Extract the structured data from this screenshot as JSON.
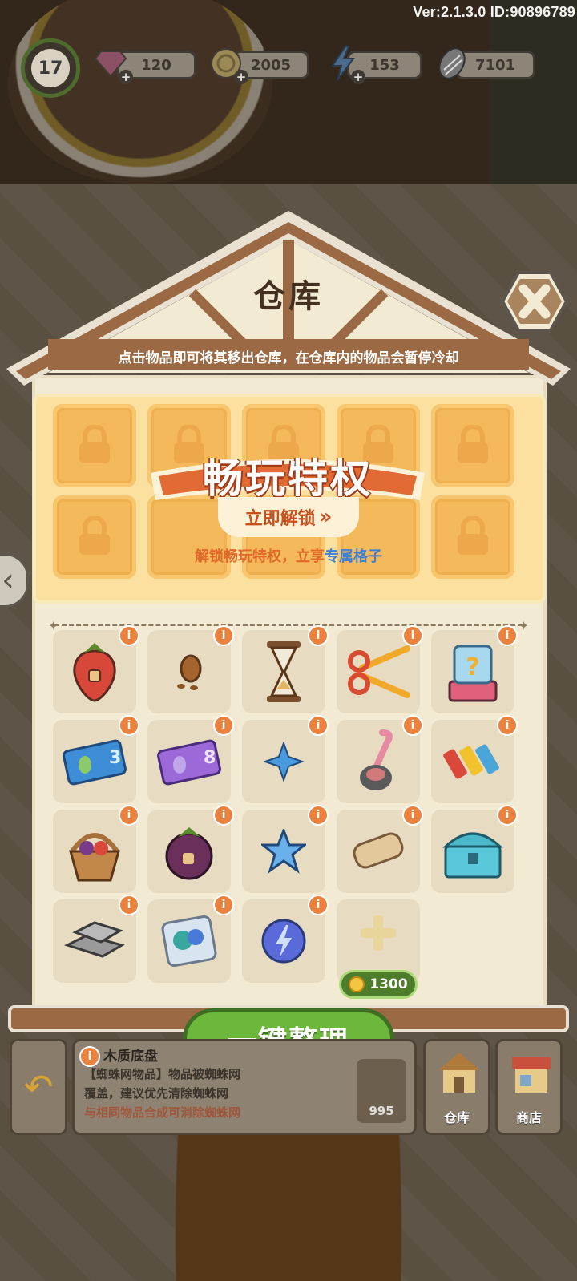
{
  "version_text": "Ver:2.1.3.0 ID:90896789",
  "top_bar": {
    "level": "17",
    "gems": "120",
    "coins": "2005",
    "energy": "153",
    "seeds": "7101"
  },
  "warehouse": {
    "title": "仓库",
    "subtitle": "点击物品即可将其移出仓库，在仓库内的物品会暂停冷却",
    "promo_title": "畅玩特权",
    "promo_button": "立即解锁",
    "promo_button_arrows": "»",
    "promo_desc_prefix": "解锁畅玩特权，立享",
    "promo_desc_highlight": "专属格子",
    "expand_price": "1300",
    "sort_button": "一键整理",
    "info_glyph": "i",
    "items": [
      {
        "icon": "strawberry-icon"
      },
      {
        "icon": "pine-seed-icon"
      },
      {
        "icon": "hourglass-icon"
      },
      {
        "icon": "scissors-icon"
      },
      {
        "icon": "mystery-box-icon"
      },
      {
        "icon": "green-seed-ticket-icon"
      },
      {
        "icon": "purple-seed-ticket-icon"
      },
      {
        "icon": "blue-sparkle-icon"
      },
      {
        "icon": "straw-cup-icon"
      },
      {
        "icon": "paint-tubes-icon"
      },
      {
        "icon": "fruit-basket-icon"
      },
      {
        "icon": "mangosteen-icon"
      },
      {
        "icon": "blue-star-icon"
      },
      {
        "icon": "scroll-icon"
      },
      {
        "icon": "treasure-chest-icon"
      },
      {
        "icon": "silver-bars-icon"
      },
      {
        "icon": "gem-pouch-icon"
      },
      {
        "icon": "energy-orb-icon"
      }
    ]
  },
  "bottom_bar": {
    "item_name": "木质底盘",
    "desc_line1": "【蜘蛛网物品】物品被蜘蛛网",
    "desc_line2": "覆盖，建议优先清除蜘蛛网",
    "desc_line3": "与相同物品合成可消除蜘蛛网",
    "gem_cost": "995",
    "warehouse_tab": "仓库",
    "shop_tab": "商店"
  },
  "colors": {
    "accent_green": "#6cb83a",
    "info_orange": "#e8823e",
    "promo_orange": "#e0692a",
    "promo_blue": "#3d7fd6"
  }
}
